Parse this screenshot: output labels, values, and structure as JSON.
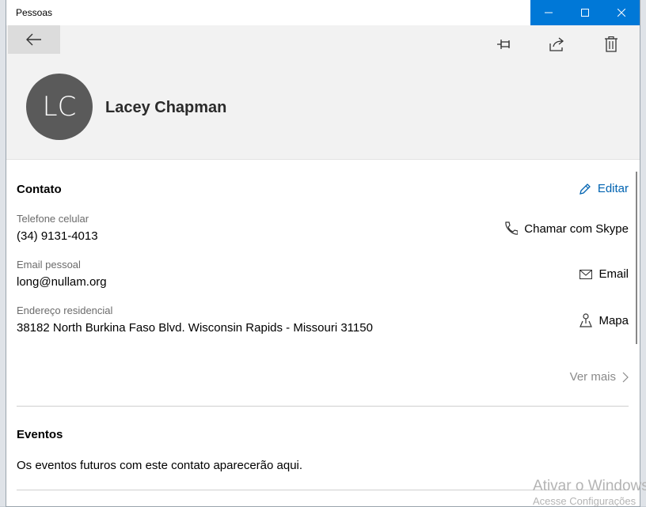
{
  "window": {
    "title": "Pessoas",
    "accent": "#0078d7"
  },
  "contact": {
    "initials": "LC",
    "name": "Lacey Chapman"
  },
  "toolbar": {
    "icons": [
      "back-arrow-icon",
      "pin-icon",
      "share-icon",
      "trash-icon"
    ]
  },
  "sections": {
    "contact": {
      "title": "Contato",
      "edit_label": "Editar"
    },
    "events": {
      "title": "Eventos",
      "message": "Os eventos futuros com este contato aparecerão aqui."
    }
  },
  "fields": {
    "mobile": {
      "label": "Telefone celular",
      "value": "(34) 9131-4013",
      "action": "Chamar com Skype"
    },
    "email": {
      "label": "Email pessoal",
      "value": "long@nullam.org",
      "action": "Email"
    },
    "address": {
      "label": "Endereço residencial",
      "value": "38182 North Burkina Faso Blvd. Wisconsin Rapids - Missouri 31150",
      "action": "Mapa"
    }
  },
  "more_label": "Ver mais",
  "watermark": {
    "line1": "Ativar o Windows",
    "line2": "Acesse Configurações"
  }
}
